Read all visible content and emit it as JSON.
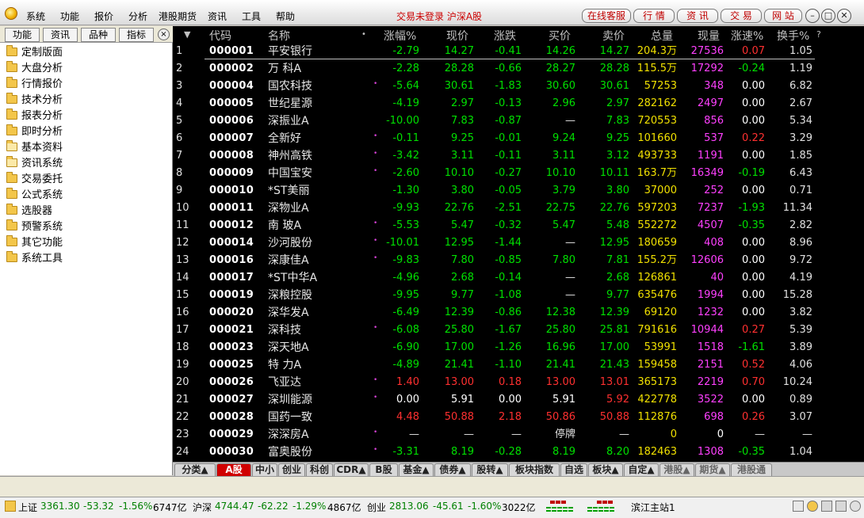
{
  "menu": [
    "系统",
    "功能",
    "报价",
    "分析",
    "港股期货",
    "资讯",
    "工具",
    "帮助"
  ],
  "status_title": "交易未登录 沪深A股",
  "title_buttons": [
    "在线客服",
    "行 情",
    "资 讯",
    "交 易",
    "网 站"
  ],
  "window_buttons": [
    "minimize-icon",
    "restore-icon",
    "close-icon"
  ],
  "sidebar": {
    "tabs": [
      "功能",
      "资讯",
      "品种",
      "指标"
    ],
    "close": "×",
    "items": [
      {
        "label": "定制版面",
        "open": false
      },
      {
        "label": "大盘分析",
        "open": false
      },
      {
        "label": "行情报价",
        "open": false
      },
      {
        "label": "技术分析",
        "open": false
      },
      {
        "label": "报表分析",
        "open": false
      },
      {
        "label": "即时分析",
        "open": false
      },
      {
        "label": "基本资料",
        "open": true
      },
      {
        "label": "资讯系统",
        "open": true
      },
      {
        "label": "交易委托",
        "open": false
      },
      {
        "label": "公式系统",
        "open": false
      },
      {
        "label": "选股器",
        "open": false
      },
      {
        "label": "预警系统",
        "open": false
      },
      {
        "label": "其它功能",
        "open": false
      },
      {
        "label": "系统工具",
        "open": false
      }
    ]
  },
  "table": {
    "sort_arrow": "▼",
    "headers": [
      "代码",
      "名称",
      "•",
      "涨幅%",
      "现价",
      "涨跌",
      "买价",
      "卖价",
      "总量",
      "现量",
      "涨速%",
      "换手%",
      "?"
    ],
    "colors": {
      "up": "#ff3030",
      "down": "#00e000",
      "flat": "#ffffff",
      "muted": "#e0e0e0"
    },
    "rows": [
      {
        "idx": "1",
        "code": "000001",
        "name": "平安银行",
        "dot": "",
        "pct": "-2.79",
        "price": "14.27",
        "chg": "-0.41",
        "bid": "14.26",
        "ask": "14.27",
        "vol": "204.3万",
        "now": "27536",
        "spd": "0.07",
        "turn": "1.05",
        "d": "down",
        "sd": "up"
      },
      {
        "idx": "2",
        "code": "000002",
        "name": "万 科A",
        "dot": "",
        "pct": "-2.28",
        "price": "28.28",
        "chg": "-0.66",
        "bid": "28.27",
        "ask": "28.28",
        "vol": "115.5万",
        "now": "17292",
        "spd": "-0.24",
        "turn": "1.19",
        "d": "down",
        "sd": "down"
      },
      {
        "idx": "3",
        "code": "000004",
        "name": "国农科技",
        "dot": "•",
        "pct": "-5.64",
        "price": "30.61",
        "chg": "-1.83",
        "bid": "30.60",
        "ask": "30.61",
        "vol": "57253",
        "now": "348",
        "spd": "0.00",
        "turn": "6.82",
        "d": "down",
        "sd": "flat"
      },
      {
        "idx": "4",
        "code": "000005",
        "name": "世纪星源",
        "dot": "",
        "pct": "-4.19",
        "price": "2.97",
        "chg": "-0.13",
        "bid": "2.96",
        "ask": "2.97",
        "vol": "282162",
        "now": "2497",
        "spd": "0.00",
        "turn": "2.67",
        "d": "down",
        "sd": "flat"
      },
      {
        "idx": "5",
        "code": "000006",
        "name": "深振业A",
        "dot": "",
        "pct": "-10.00",
        "price": "7.83",
        "chg": "-0.87",
        "bid": "—",
        "ask": "7.83",
        "vol": "720553",
        "now": "856",
        "spd": "0.00",
        "turn": "5.34",
        "d": "down",
        "sd": "flat"
      },
      {
        "idx": "6",
        "code": "000007",
        "name": "全新好",
        "dot": "•",
        "pct": "-0.11",
        "price": "9.25",
        "chg": "-0.01",
        "bid": "9.24",
        "ask": "9.25",
        "vol": "101660",
        "now": "537",
        "spd": "0.22",
        "turn": "3.29",
        "d": "down",
        "sd": "up"
      },
      {
        "idx": "7",
        "code": "000008",
        "name": "神州高铁",
        "dot": "•",
        "pct": "-3.42",
        "price": "3.11",
        "chg": "-0.11",
        "bid": "3.11",
        "ask": "3.12",
        "vol": "493733",
        "now": "1191",
        "spd": "0.00",
        "turn": "1.85",
        "d": "down",
        "sd": "flat"
      },
      {
        "idx": "8",
        "code": "000009",
        "name": "中国宝安",
        "dot": "•",
        "pct": "-2.60",
        "price": "10.10",
        "chg": "-0.27",
        "bid": "10.10",
        "ask": "10.11",
        "vol": "163.7万",
        "now": "16349",
        "spd": "-0.19",
        "turn": "6.43",
        "d": "down",
        "sd": "down"
      },
      {
        "idx": "9",
        "code": "000010",
        "name": "*ST美丽",
        "dot": "",
        "pct": "-1.30",
        "price": "3.80",
        "chg": "-0.05",
        "bid": "3.79",
        "ask": "3.80",
        "vol": "37000",
        "now": "252",
        "spd": "0.00",
        "turn": "0.71",
        "d": "down",
        "sd": "flat"
      },
      {
        "idx": "10",
        "code": "000011",
        "name": "深物业A",
        "dot": "",
        "pct": "-9.93",
        "price": "22.76",
        "chg": "-2.51",
        "bid": "22.75",
        "ask": "22.76",
        "vol": "597203",
        "now": "7237",
        "spd": "-1.93",
        "turn": "11.34",
        "d": "down",
        "sd": "down"
      },
      {
        "idx": "11",
        "code": "000012",
        "name": "南 玻A",
        "dot": "•",
        "pct": "-5.53",
        "price": "5.47",
        "chg": "-0.32",
        "bid": "5.47",
        "ask": "5.48",
        "vol": "552272",
        "now": "4507",
        "spd": "-0.35",
        "turn": "2.82",
        "d": "down",
        "sd": "down"
      },
      {
        "idx": "12",
        "code": "000014",
        "name": "沙河股份",
        "dot": "•",
        "pct": "-10.01",
        "price": "12.95",
        "chg": "-1.44",
        "bid": "—",
        "ask": "12.95",
        "vol": "180659",
        "now": "408",
        "spd": "0.00",
        "turn": "8.96",
        "d": "down",
        "sd": "flat"
      },
      {
        "idx": "13",
        "code": "000016",
        "name": "深康佳A",
        "dot": "•",
        "pct": "-9.83",
        "price": "7.80",
        "chg": "-0.85",
        "bid": "7.80",
        "ask": "7.81",
        "vol": "155.2万",
        "now": "12606",
        "spd": "0.00",
        "turn": "9.72",
        "d": "down",
        "sd": "flat"
      },
      {
        "idx": "14",
        "code": "000017",
        "name": "*ST中华A",
        "dot": "",
        "pct": "-4.96",
        "price": "2.68",
        "chg": "-0.14",
        "bid": "—",
        "ask": "2.68",
        "vol": "126861",
        "now": "40",
        "spd": "0.00",
        "turn": "4.19",
        "d": "down",
        "sd": "flat"
      },
      {
        "idx": "15",
        "code": "000019",
        "name": "深粮控股",
        "dot": "",
        "pct": "-9.95",
        "price": "9.77",
        "chg": "-1.08",
        "bid": "—",
        "ask": "9.77",
        "vol": "635476",
        "now": "1994",
        "spd": "0.00",
        "turn": "15.28",
        "d": "down",
        "sd": "flat"
      },
      {
        "idx": "16",
        "code": "000020",
        "name": "深华发A",
        "dot": "",
        "pct": "-6.49",
        "price": "12.39",
        "chg": "-0.86",
        "bid": "12.38",
        "ask": "12.39",
        "vol": "69120",
        "now": "1232",
        "spd": "0.00",
        "turn": "3.82",
        "d": "down",
        "sd": "flat"
      },
      {
        "idx": "17",
        "code": "000021",
        "name": "深科技",
        "dot": "•",
        "pct": "-6.08",
        "price": "25.80",
        "chg": "-1.67",
        "bid": "25.80",
        "ask": "25.81",
        "vol": "791616",
        "now": "10944",
        "spd": "0.27",
        "turn": "5.39",
        "d": "down",
        "sd": "up"
      },
      {
        "idx": "18",
        "code": "000023",
        "name": "深天地A",
        "dot": "",
        "pct": "-6.90",
        "price": "17.00",
        "chg": "-1.26",
        "bid": "16.96",
        "ask": "17.00",
        "vol": "53991",
        "now": "1518",
        "spd": "-1.61",
        "turn": "3.89",
        "d": "down",
        "sd": "down"
      },
      {
        "idx": "19",
        "code": "000025",
        "name": "特 力A",
        "dot": "",
        "pct": "-4.89",
        "price": "21.41",
        "chg": "-1.10",
        "bid": "21.41",
        "ask": "21.43",
        "vol": "159458",
        "now": "2151",
        "spd": "0.52",
        "turn": "4.06",
        "d": "down",
        "sd": "up"
      },
      {
        "idx": "20",
        "code": "000026",
        "name": "飞亚达",
        "dot": "•",
        "pct": "1.40",
        "price": "13.00",
        "chg": "0.18",
        "bid": "13.00",
        "ask": "13.01",
        "vol": "365173",
        "now": "2219",
        "spd": "0.70",
        "turn": "10.24",
        "d": "up",
        "sd": "up"
      },
      {
        "idx": "21",
        "code": "000027",
        "name": "深圳能源",
        "dot": "•",
        "pct": "0.00",
        "price": "5.91",
        "chg": "0.00",
        "bid": "5.91",
        "ask": "5.92",
        "vol": "422778",
        "now": "3522",
        "spd": "0.00",
        "turn": "0.89",
        "d": "flat",
        "sd": "flat",
        "askd": "up"
      },
      {
        "idx": "22",
        "code": "000028",
        "name": "国药一致",
        "dot": "",
        "pct": "4.48",
        "price": "50.88",
        "chg": "2.18",
        "bid": "50.86",
        "ask": "50.88",
        "vol": "112876",
        "now": "698",
        "spd": "0.26",
        "turn": "3.07",
        "d": "up",
        "sd": "up"
      },
      {
        "idx": "23",
        "code": "000029",
        "name": "深深房A",
        "dot": "•",
        "pct": "—",
        "price": "—",
        "chg": "—",
        "bid": "停牌",
        "ask": "—",
        "vol": "0",
        "now": "0",
        "spd": "—",
        "turn": "—",
        "d": "flat",
        "sd": "flat",
        "nowd": "flat"
      },
      {
        "idx": "24",
        "code": "000030",
        "name": "富奥股份",
        "dot": "•",
        "pct": "-3.31",
        "price": "8.19",
        "chg": "-0.28",
        "bid": "8.19",
        "ask": "8.20",
        "vol": "182463",
        "now": "1308",
        "spd": "-0.35",
        "turn": "1.04",
        "d": "down",
        "sd": "down"
      }
    ]
  },
  "bottom_tabs": [
    {
      "label": "分类▲",
      "active": false,
      "dim": false
    },
    {
      "label": "A股",
      "active": true,
      "dim": false
    },
    {
      "label": "中小",
      "active": false,
      "dim": false
    },
    {
      "label": "创业",
      "active": false,
      "dim": false
    },
    {
      "label": "科创",
      "active": false,
      "dim": false
    },
    {
      "label": "CDR▲",
      "active": false,
      "dim": false
    },
    {
      "label": "B股",
      "active": false,
      "dim": false
    },
    {
      "label": "基金▲",
      "active": false,
      "dim": false
    },
    {
      "label": "债券▲",
      "active": false,
      "dim": false
    },
    {
      "label": "股转▲",
      "active": false,
      "dim": false
    },
    {
      "label": "板块指数",
      "active": false,
      "dim": false
    },
    {
      "label": "自选",
      "active": false,
      "dim": false
    },
    {
      "label": "板块▲",
      "active": false,
      "dim": false
    },
    {
      "label": "自定▲",
      "active": false,
      "dim": false
    },
    {
      "label": "港股▲",
      "active": false,
      "dim": true
    },
    {
      "label": "期货▲",
      "active": false,
      "dim": true
    },
    {
      "label": "港股通",
      "active": false,
      "dim": true
    }
  ],
  "statusbar": {
    "sh": {
      "name": "上证",
      "value": "3361.30",
      "chg": "-53.32",
      "pct": "-1.56%",
      "amt": "6747亿"
    },
    "sz": {
      "name": "沪深",
      "value": "4744.47",
      "chg": "-62.22",
      "pct": "-1.29%",
      "amt": "4867亿"
    },
    "cy": {
      "name": "创业",
      "value": "2813.06",
      "chg": "-45.61",
      "pct": "-1.60%",
      "amt": "3022亿"
    },
    "server": "滨江主站1"
  }
}
